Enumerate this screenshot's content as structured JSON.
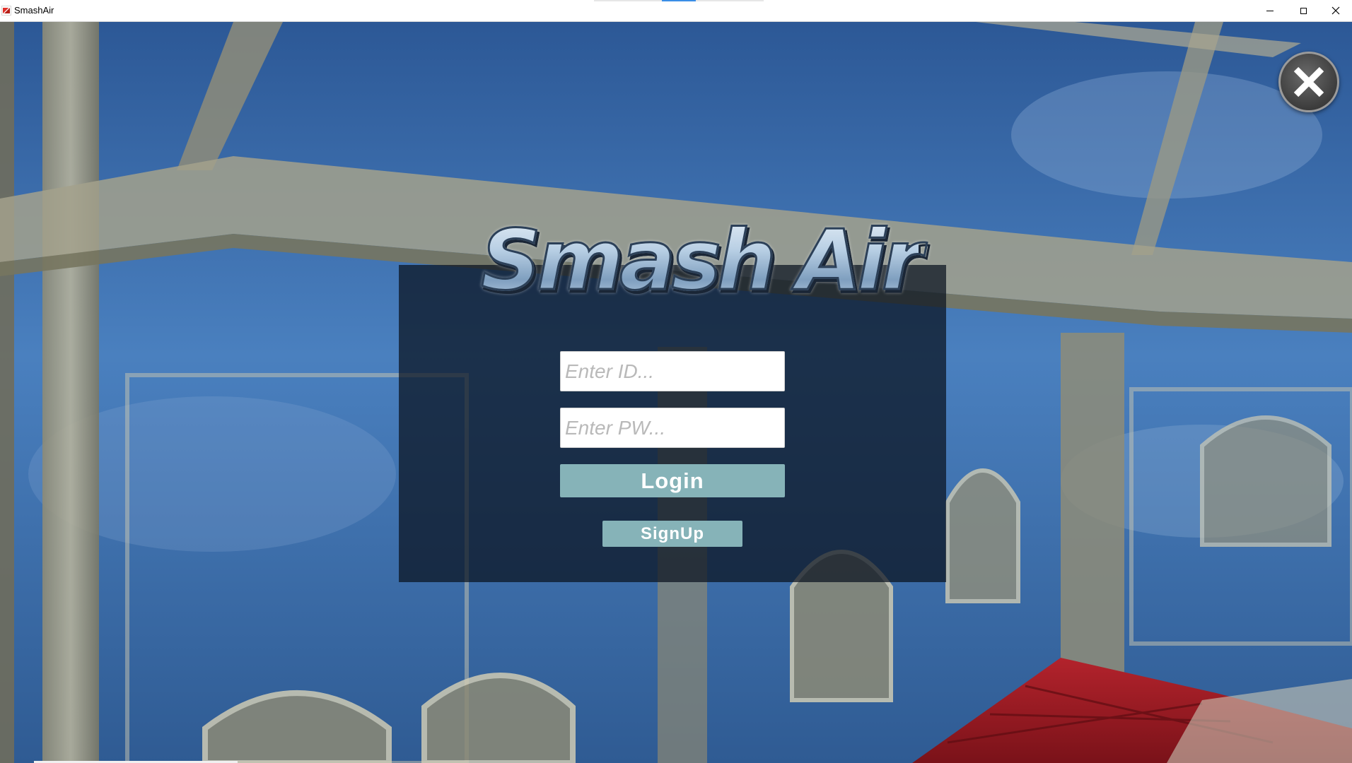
{
  "window": {
    "title": "SmashAir",
    "controls": {
      "minimize_icon": "minimize-icon",
      "maximize_icon": "maximize-icon",
      "close_icon": "close-icon"
    }
  },
  "game": {
    "logo_text": "Smash Air",
    "close_icon": "close-x-icon",
    "login": {
      "id_placeholder": "Enter ID...",
      "id_value": "",
      "pw_placeholder": "Enter PW...",
      "pw_value": "",
      "login_label": "Login",
      "signup_label": "SignUp"
    }
  },
  "colors": {
    "button_bg": "#86b3b8",
    "button_text": "#ffffff",
    "panel_bg": "rgba(10,18,30,0.72)",
    "sky": "#3c6fae",
    "roof_red": "#a81c24"
  }
}
